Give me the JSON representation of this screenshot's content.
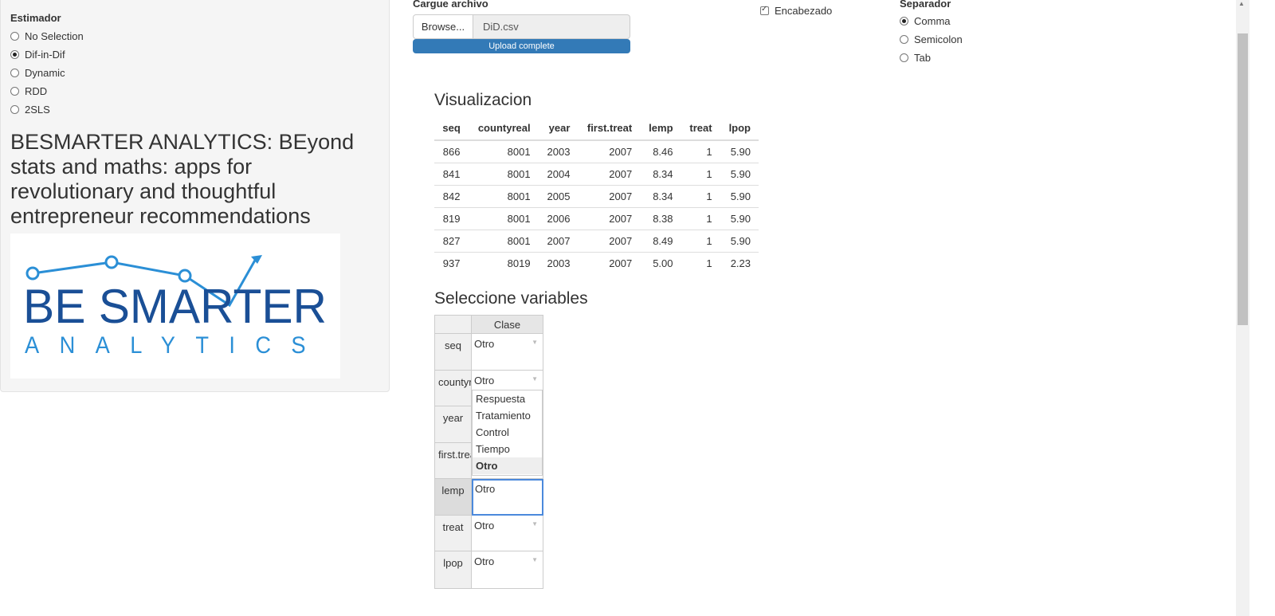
{
  "sidebar": {
    "estimator_label": "Estimador",
    "estimators": [
      {
        "label": "No Selection",
        "checked": false
      },
      {
        "label": "Dif-in-Dif",
        "checked": true
      },
      {
        "label": "Dynamic",
        "checked": false
      },
      {
        "label": "RDD",
        "checked": false
      },
      {
        "label": "2SLS",
        "checked": false
      }
    ],
    "brand_title": "BESMARTER ANALYTICS: BEyond stats and maths: apps for revolutionary and thoughtful entrepreneur recommendations",
    "logo_text_main": "BE SMARTER",
    "logo_text_sub": "ANALYTICS"
  },
  "upload": {
    "label": "Cargue archivo",
    "browse_label": "Browse...",
    "file_name": "DiD.csv",
    "progress_label": "Upload complete",
    "progress": 1.0
  },
  "header_option": {
    "label": "Encabezado",
    "checked": true
  },
  "separator": {
    "label": "Separador",
    "options": [
      {
        "label": "Comma",
        "checked": true
      },
      {
        "label": "Semicolon",
        "checked": false
      },
      {
        "label": "Tab",
        "checked": false
      }
    ]
  },
  "visualization": {
    "title": "Visualizacion",
    "columns": [
      "seq",
      "countyreal",
      "year",
      "first.treat",
      "lemp",
      "treat",
      "lpop"
    ],
    "rows": [
      [
        "866",
        "8001",
        "2003",
        "2007",
        "8.46",
        "1",
        "5.90"
      ],
      [
        "841",
        "8001",
        "2004",
        "2007",
        "8.34",
        "1",
        "5.90"
      ],
      [
        "842",
        "8001",
        "2005",
        "2007",
        "8.34",
        "1",
        "5.90"
      ],
      [
        "819",
        "8001",
        "2006",
        "2007",
        "8.38",
        "1",
        "5.90"
      ],
      [
        "827",
        "8001",
        "2007",
        "2007",
        "8.49",
        "1",
        "5.90"
      ],
      [
        "937",
        "8019",
        "2003",
        "2007",
        "5.00",
        "1",
        "2.23"
      ]
    ]
  },
  "variables": {
    "title": "Seleccione variables",
    "column_header": "Clase",
    "rows": [
      {
        "name": "seq",
        "value": "Otro"
      },
      {
        "name": "countyreal",
        "value": "Otro"
      },
      {
        "name": "year",
        "value": ""
      },
      {
        "name": "first.treat",
        "value": ""
      },
      {
        "name": "lemp",
        "value": "Otro"
      },
      {
        "name": "treat",
        "value": "Otro"
      },
      {
        "name": "lpop",
        "value": "Otro"
      }
    ],
    "dropdown_options": [
      "Respuesta",
      "Tratamiento",
      "Control",
      "Tiempo",
      "Otro"
    ],
    "dropdown_selected": "Otro"
  },
  "colors": {
    "accent": "#337ab7",
    "logo_dark": "#1a4f96",
    "logo_light": "#2b8fd6"
  }
}
